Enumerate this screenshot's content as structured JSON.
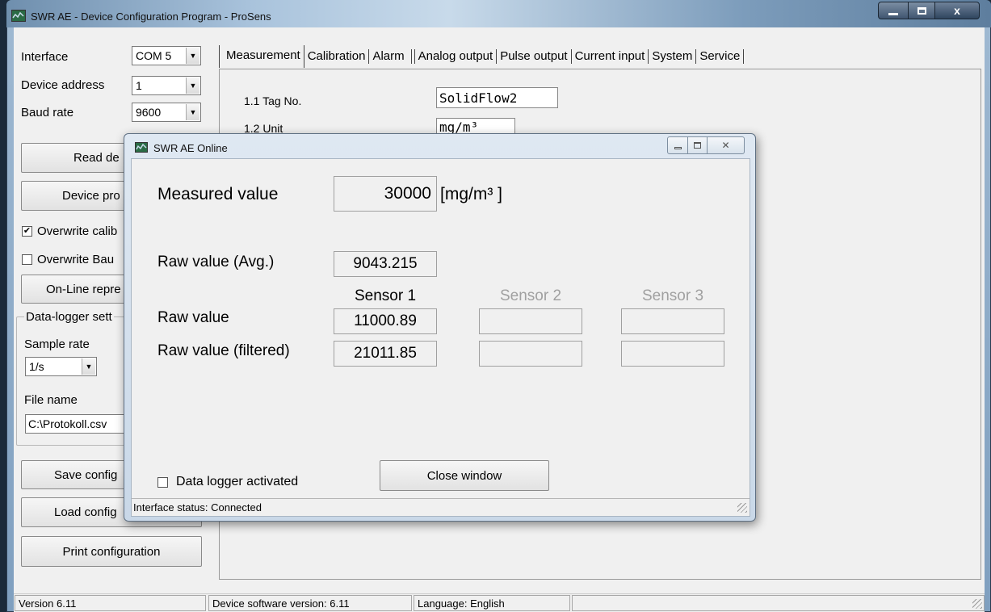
{
  "window": {
    "title": "SWR AE - Device Configuration Program - ProSens"
  },
  "left_panel": {
    "interface_label": "Interface",
    "interface_value": "COM 5",
    "device_address_label": "Device address",
    "device_address_value": "1",
    "baud_rate_label": "Baud rate",
    "baud_rate_value": "9600",
    "read_button": "Read de",
    "device_button": "Device pro",
    "overwrite_cal_label": "Overwrite calib",
    "overwrite_baud_label": "Overwrite Bau",
    "online_button": "On-Line repre",
    "datalogger_group": "Data-logger sett",
    "sample_rate_label": "Sample rate",
    "sample_rate_value": "1/s",
    "file_name_label": "File name",
    "file_name_value": "C:\\Protokoll.csv",
    "save_button": "Save config",
    "load_button": "Load config",
    "print_button": "Print configuration"
  },
  "tabs": [
    "Measurement",
    "Calibration",
    "Alarm",
    "Analog output",
    "Pulse output",
    "Current input",
    "System",
    "Service"
  ],
  "measurement": {
    "tag_label": "1.1 Tag No.",
    "tag_value": "SolidFlow2",
    "unit_label": "1.2 Unit",
    "unit_value": "mg/m³"
  },
  "statusbar": {
    "version": "Version 6.11",
    "device_sw": "Device software version: 6.11",
    "language": "Language: English"
  },
  "dialog": {
    "title": "SWR AE Online",
    "measured_label": "Measured value",
    "measured_value": "30000",
    "measured_unit": "[mg/m³ ]",
    "raw_avg_label": "Raw value (Avg.)",
    "raw_avg_value": "9043.215",
    "sensor_headers": [
      "Sensor 1",
      "Sensor 2",
      "Sensor 3"
    ],
    "raw_label": "Raw value",
    "raw_values": [
      "11000.89",
      "",
      ""
    ],
    "filtered_label": "Raw value (filtered)",
    "filtered_values": [
      "21011.85",
      "",
      ""
    ],
    "datalogger_label": "Data logger activated",
    "close_button": "Close window",
    "status": "Interface status: Connected"
  }
}
